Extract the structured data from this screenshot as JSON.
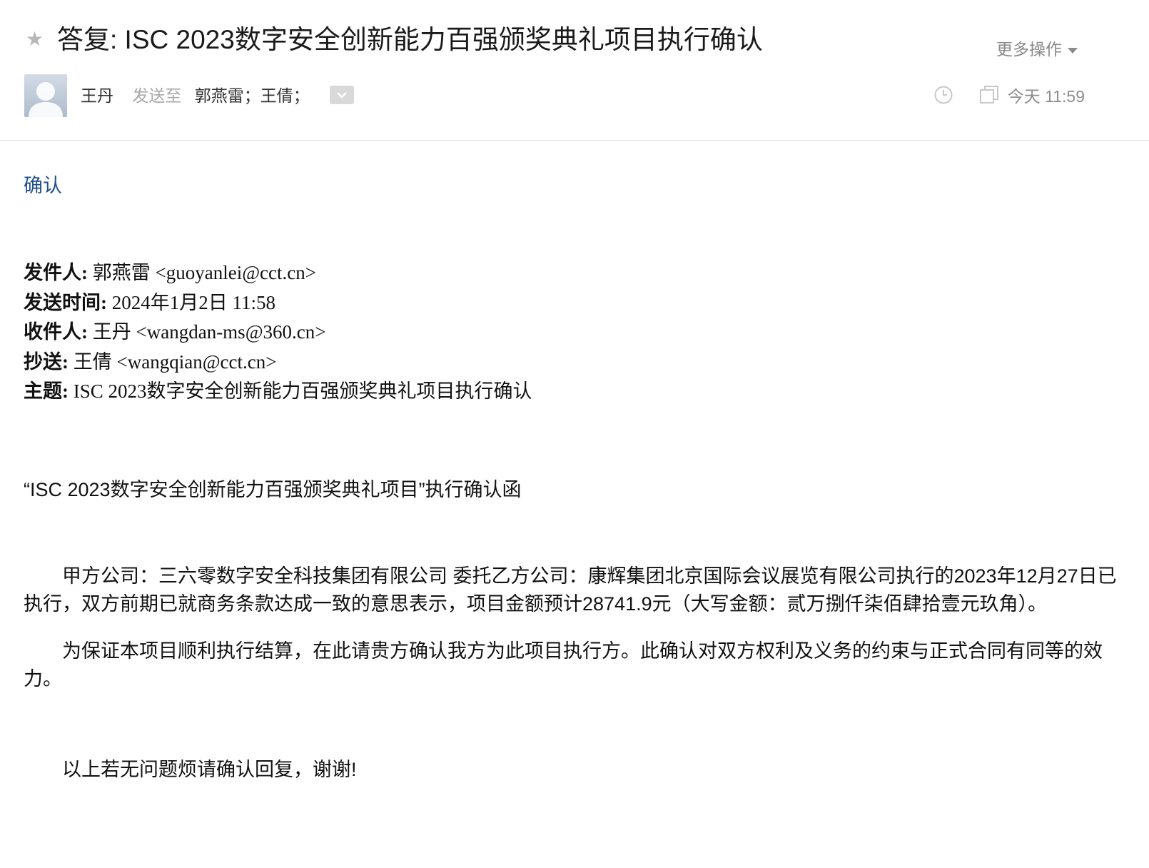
{
  "header": {
    "subject": "答复: ISC 2023数字安全创新能力百强颁奖典礼项目执行确认",
    "more_actions_label": "更多操作",
    "sender_name": "王丹",
    "sent_to_label": "发送至",
    "recipients": "郭燕雷；王倩；",
    "time": "今天 11:59"
  },
  "body": {
    "reply_text": "确认",
    "quoted": {
      "from_label": "发件人:",
      "from_value": "郭燕雷 <guoyanlei@cct.cn>",
      "sent_label": "发送时间:",
      "sent_value": "2024年1月2日 11:58",
      "to_label": "收件人:",
      "to_value": "王丹 <wangdan-ms@360.cn>",
      "cc_label": "抄送:",
      "cc_value": "王倩 <wangqian@cct.cn>",
      "subject_label": "主题:",
      "subject_value": "ISC 2023数字安全创新能力百强颁奖典礼项目执行确认"
    },
    "letter_title": "“ISC 2023数字安全创新能力百强颁奖典礼项目”执行确认函",
    "paragraph1": "甲方公司：三六零数字安全科技集团有限公司 委托乙方公司：康辉集团北京国际会议展览有限公司执行的2023年12月27日已执行，双方前期已就商务条款达成一致的意思表示，项目金额预计28741.9元（大写金额：贰万捌仟柒佰肆拾壹元玖角）。",
    "paragraph2": "为保证本项目顺利执行结算，在此请贵方确认我方为此项目执行方。此确认对双方权利及义务的约束与正式合同有同等的效力。",
    "paragraph3": "以上若无问题烦请确认回复，谢谢!"
  }
}
